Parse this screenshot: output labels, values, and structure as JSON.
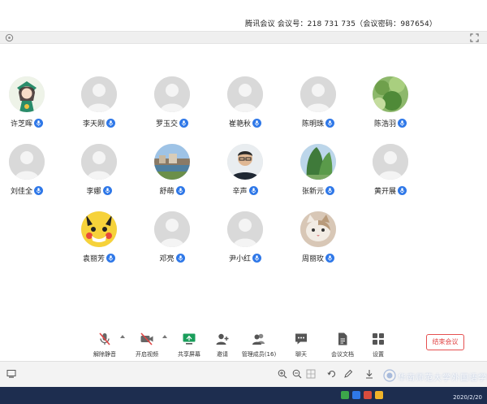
{
  "window": {
    "title": "腾讯会议 会议号：218 731 735（会议密码：987654）"
  },
  "participants": [
    {
      "name": "许芝晖",
      "avatar": "cartoon-girl"
    },
    {
      "name": "李天刚",
      "avatar": "default"
    },
    {
      "name": "罗玉交",
      "avatar": "default"
    },
    {
      "name": "崔艳秋",
      "avatar": "default"
    },
    {
      "name": "陈明珠",
      "avatar": "default"
    },
    {
      "name": "陈浩羽",
      "avatar": "plant-photo"
    },
    {
      "name": "刘佳全",
      "avatar": "default"
    },
    {
      "name": "李娜",
      "avatar": "default"
    },
    {
      "name": "舒萌",
      "avatar": "landscape-photo"
    },
    {
      "name": "辛声",
      "avatar": "man-with-glasses"
    },
    {
      "name": "张新元",
      "avatar": "tree-photo"
    },
    {
      "name": "黄开展",
      "avatar": "default"
    },
    {
      "name": "袁丽芳",
      "avatar": "pikachu"
    },
    {
      "name": "邓亮",
      "avatar": "default"
    },
    {
      "name": "尹小红",
      "avatar": "default"
    },
    {
      "name": "周丽玫",
      "avatar": "cat-photo"
    }
  ],
  "toolbar": {
    "unmute": "解除静音",
    "start_video": "开启视频",
    "share_screen": "共享屏幕",
    "invite": "邀请",
    "manage_members": "管理成员(16)",
    "chat": "聊天",
    "meeting_docs": "会议文档",
    "settings": "设置",
    "leave": "结束会议"
  },
  "watermark": {
    "text": "华南师范大学外国语学院"
  },
  "taskbar": {
    "date": "2020/2/20"
  },
  "colors": {
    "accent": "#2f78e8",
    "leave": "#e04545",
    "taskbar": "#1d2d4f"
  }
}
